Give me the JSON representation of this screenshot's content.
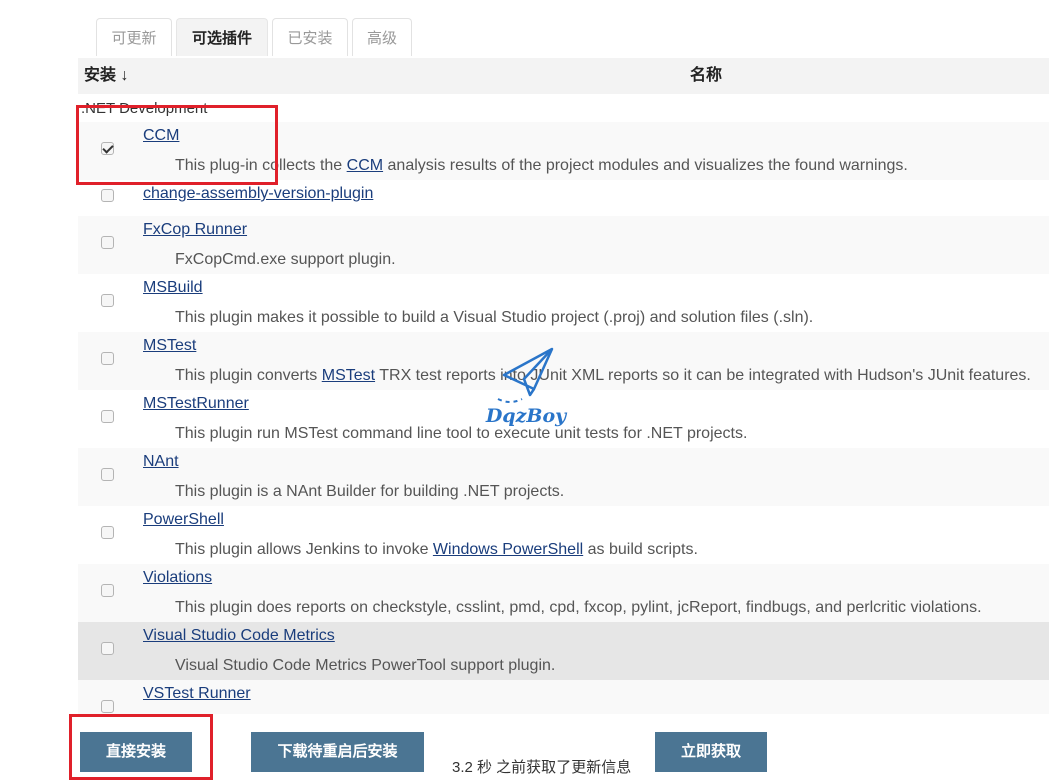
{
  "tabs": [
    {
      "label": "可更新",
      "active": false
    },
    {
      "label": "可选插件",
      "active": true
    },
    {
      "label": "已安装",
      "active": false
    },
    {
      "label": "高级",
      "active": false
    }
  ],
  "table": {
    "header_install": "安装 ↓",
    "header_name": "名称",
    "category": ".NET Development"
  },
  "plugins": [
    {
      "name": "CCM",
      "checked": true,
      "desc_pre": "This plug-in collects the ",
      "desc_link": "CCM",
      "desc_post": " analysis results of the project modules and visualizes the found warnings."
    },
    {
      "name": "change-assembly-version-plugin",
      "checked": false
    },
    {
      "name": "FxCop Runner",
      "checked": false,
      "desc": "FxCopCmd.exe support plugin."
    },
    {
      "name": "MSBuild",
      "checked": false,
      "desc": "This plugin makes it possible to build a Visual Studio project (.proj) and solution files (.sln)."
    },
    {
      "name": "MSTest",
      "checked": false,
      "desc_pre": "This plugin converts ",
      "desc_link": "MSTest",
      "desc_post": " TRX test reports into JUnit XML reports so it can be integrated with Hudson's JUnit features."
    },
    {
      "name": "MSTestRunner",
      "checked": false,
      "desc": "This plugin run MSTest command line tool to execute unit tests for .NET projects."
    },
    {
      "name": "NAnt",
      "checked": false,
      "desc": "This plugin is a NAnt Builder for building .NET projects."
    },
    {
      "name": "PowerShell",
      "checked": false,
      "desc_pre": "This plugin allows Jenkins to invoke ",
      "desc_link": "Windows PowerShell",
      "desc_post": " as build scripts."
    },
    {
      "name": "Violations",
      "checked": false,
      "desc": "This plugin does reports on checkstyle, csslint, pmd, cpd, fxcop, pylint, jcReport, findbugs, and perlcritic violations."
    },
    {
      "name": "Visual Studio Code Metrics",
      "checked": false,
      "desc": "Visual Studio Code Metrics PowerTool support plugin."
    },
    {
      "name": "VSTest Runner",
      "checked": false
    }
  ],
  "actions": {
    "install_now": "直接安装",
    "install_after_restart": "下载待重启后安装",
    "status": "3.2 秒 之前获取了更新信息",
    "check_now": "立即获取"
  },
  "watermark": "DqzBoy",
  "colors": {
    "button": "#4b7593",
    "link": "#1a3d7c",
    "highlight_box": "#e0202a"
  }
}
